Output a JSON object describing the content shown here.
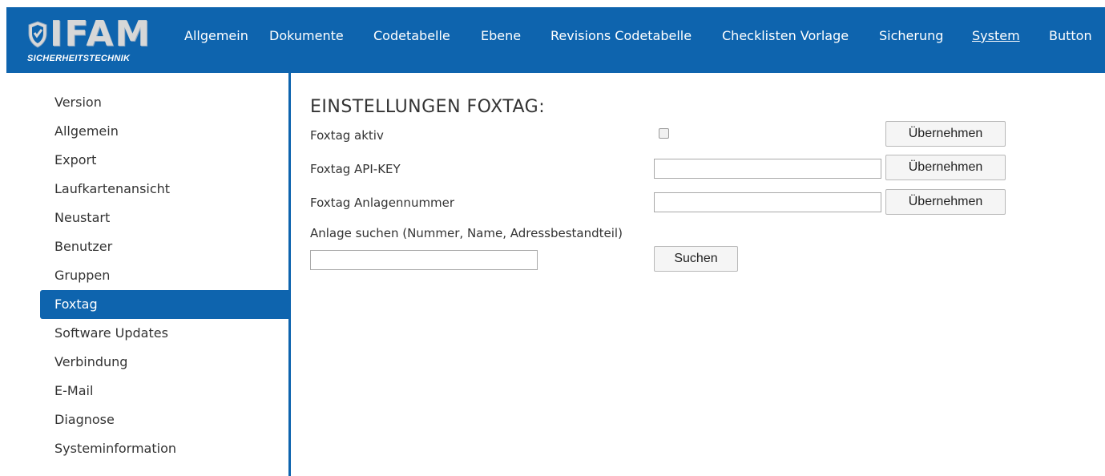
{
  "logo": {
    "main": "IFAM",
    "sub": "SICHERHEITSTECHNIK"
  },
  "nav": {
    "items": [
      "Allgemein",
      "Dokumente",
      "Codetabelle",
      "Ebene",
      "Revisions Codetabelle",
      "Checklisten Vorlage",
      "Sicherung",
      "System",
      "Button"
    ],
    "active": "System"
  },
  "sidebar": {
    "items": [
      "Version",
      "Allgemein",
      "Export",
      "Laufkartenansicht",
      "Neustart",
      "Benutzer",
      "Gruppen",
      "Foxtag",
      "Software Updates",
      "Verbindung",
      "E-Mail",
      "Diagnose",
      "Systeminformation"
    ],
    "active": "Foxtag"
  },
  "main": {
    "title": "EINSTELLUNGEN FOXTAG:",
    "foxtag_active": {
      "label": "Foxtag aktiv",
      "checked": false,
      "button": "Übernehmen"
    },
    "api_key": {
      "label": "Foxtag API-KEY",
      "value": "",
      "button": "Übernehmen"
    },
    "plant_number": {
      "label": "Foxtag Anlagennummer",
      "value": "",
      "button": "Übernehmen"
    },
    "search": {
      "label": "Anlage suchen (Nummer, Name, Adressbestandteil)",
      "value": "",
      "button": "Suchen"
    }
  },
  "colors": {
    "brand": "#0e64ae",
    "logo_text": "#d7d7d7"
  }
}
